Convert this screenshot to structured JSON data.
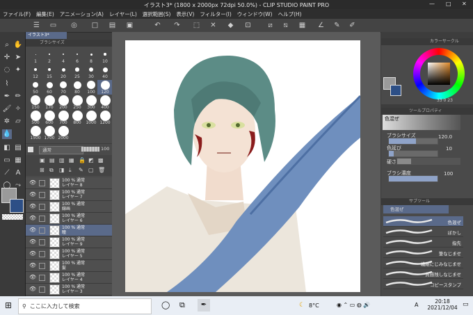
{
  "window": {
    "title": "イラスト3* (1800 x 2000px 72dpi 50.0%) - CLIP STUDIO PAINT PRO",
    "controls": [
      "—",
      "□",
      "✕"
    ]
  },
  "menu": [
    "ファイル(F)",
    "編集(E)",
    "アニメーション(A)",
    "レイヤー(L)",
    "選択範囲(S)",
    "表示(V)",
    "フィルター(I)",
    "ウィンドウ(W)",
    "ヘルプ(H)"
  ],
  "doc_tab": "イラスト3*",
  "brush_size": {
    "header": "ブラシサイズ",
    "sizes": [
      "1",
      "2",
      "4",
      "6",
      "8",
      "10",
      "12",
      "15",
      "20",
      "25",
      "30",
      "40",
      "50",
      "60",
      "70",
      "80",
      "100",
      "120",
      "150",
      "170",
      "200",
      "250",
      "300",
      "400",
      "500",
      "600",
      "700",
      "800",
      "1000",
      "1200",
      "1500",
      "1700",
      "2000"
    ],
    "selected": "120"
  },
  "layer": {
    "blend_mode": "通常",
    "opacity": "100",
    "rows": [
      {
        "line1": "100 % 通常",
        "line2": "レイヤー 8"
      },
      {
        "line1": "100 % 通常",
        "line2": "レイヤー 7"
      },
      {
        "line1": "100 % 通常",
        "line2": "線画"
      },
      {
        "line1": "100 % 通常",
        "line2": "レイヤー 6"
      },
      {
        "line1": "100 % 通常",
        "line2": "瞳"
      },
      {
        "line1": "100 % 通常",
        "line2": "レイヤー 9"
      },
      {
        "line1": "100 % 通常",
        "line2": "レイヤー 5"
      },
      {
        "line1": "100 % 通常",
        "line2": "髪"
      },
      {
        "line1": "100 % 通常",
        "line2": "レイヤー 4"
      },
      {
        "line1": "100 % 通常",
        "line2": "レイヤー 3"
      }
    ],
    "selected_index": 4
  },
  "color_circle": {
    "header": "カラーサークル",
    "readout": "33 0 23"
  },
  "tool_property": {
    "header": "ツールプロパティ",
    "tool_name": "色混ぜ",
    "brush_size_label": "ブラシサイズ",
    "brush_size_value": "120.0",
    "blend_label": "色延び",
    "blend_value": "10",
    "hardness_label": "硬さ",
    "density_label": "ブラシ濃度",
    "density_value": "100"
  },
  "sub_tool": {
    "header": "サブツール",
    "group": "色混ぜ",
    "items": [
      "色混ぜ",
      "ぼかし",
      "指先",
      "筆なじませ",
      "繊維にじみなじませ",
      "質感残しなじませ",
      "コピースタンプ"
    ],
    "selected": "色混ぜ"
  },
  "taskbar": {
    "search_placeholder": "ここに入力して検索",
    "weather": "8°C",
    "ime": "A",
    "time": "20:18",
    "date": "2021/12/04"
  },
  "colors": {
    "accent": "#8fa3c8",
    "selection": "#5a6a8a"
  }
}
